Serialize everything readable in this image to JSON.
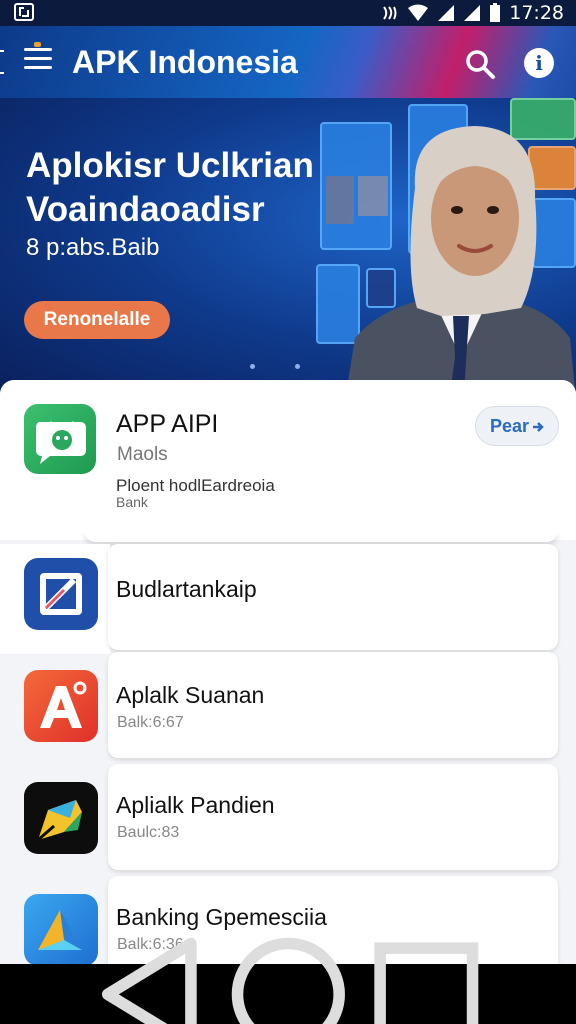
{
  "status_bar": {
    "time": "17:28"
  },
  "app_bar": {
    "title": "APK Indonesia",
    "icons": [
      "menu-icon",
      "search-icon",
      "info-icon"
    ]
  },
  "banner": {
    "headline_line1": "Aplokisr Uclkrian",
    "headline_line2": "Voaindaoadisr",
    "subtitle": "8 p:abs.Baib",
    "cta_label": "Renonelalle"
  },
  "featured": {
    "title": "APP AIPI",
    "subtitle": "Maols",
    "description": "Ploent hodlEardreoia",
    "note": "Bank",
    "button_label": "Pear",
    "icon": "android-chat-icon"
  },
  "apps": [
    {
      "name": "Budlartankaip",
      "meta": "",
      "icon": "edit-square-icon",
      "color": "#1f4fa8"
    },
    {
      "name": "Aplalk Suanan",
      "meta": "Balk:6:67",
      "icon": "letter-a-icon",
      "color": "#e8462a"
    },
    {
      "name": "Aplialk Pandien",
      "meta": "Baulc:83",
      "icon": "colorful-feather-icon",
      "color": "#111111"
    },
    {
      "name": "Banking Gpemesciia",
      "meta": "Balk:6:36",
      "icon": "triangle-logo-icon",
      "color": "#2a90e0"
    }
  ],
  "colors": {
    "accent": "#1566c4",
    "cta": "#e8784a",
    "magenta": "#c21f6a"
  }
}
